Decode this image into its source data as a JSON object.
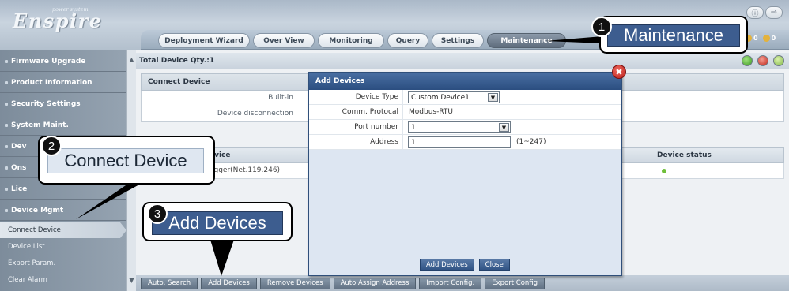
{
  "app": {
    "logo_sub": "power system",
    "logo_main": "Enspire"
  },
  "header": {
    "tabs": [
      {
        "label": "Deployment Wizard"
      },
      {
        "label": "Over View"
      },
      {
        "label": "Monitoring"
      },
      {
        "label": "Query"
      },
      {
        "label": "Settings"
      },
      {
        "label": "Maintenance"
      }
    ],
    "controls": [
      "help-icon",
      "logout-icon"
    ],
    "alarm_counts": [
      "0",
      "0"
    ]
  },
  "sidebar": {
    "items": [
      {
        "label": "Firmware Upgrade"
      },
      {
        "label": "Product Information"
      },
      {
        "label": "Security Settings"
      },
      {
        "label": "System Maint."
      },
      {
        "label": "Dev"
      },
      {
        "label": "Ons"
      },
      {
        "label": "Lice"
      },
      {
        "label": "Device Mgmt"
      }
    ],
    "sub_items": [
      {
        "label": "Connect Device"
      },
      {
        "label": "Device List"
      },
      {
        "label": "Export Param."
      },
      {
        "label": "Clear Alarm"
      }
    ]
  },
  "main": {
    "total_qty": "Total Device Qty.:1",
    "section_title": "Connect Device",
    "row1_label": "Built-in",
    "row2_label": "Device disconnection",
    "grid_col_device": "evice",
    "grid_col_status": "Device status",
    "grid_row_device": "ogger(Net.119.246)",
    "status_colors": [
      "#5cbf3d",
      "#d93a2b",
      "#9acd5e"
    ]
  },
  "bottom_buttons": [
    {
      "label": "Auto. Search"
    },
    {
      "label": "Add Devices"
    },
    {
      "label": "Remove Devices"
    },
    {
      "label": "Auto Assign Address"
    },
    {
      "label": "Import Config."
    },
    {
      "label": "Export Config"
    }
  ],
  "dialog": {
    "title": "Add Devices",
    "device_type_label": "Device Type",
    "device_type_value": "Custom Device1",
    "protocol_label": "Comm. Protocal",
    "protocol_value": "Modbus-RTU",
    "port_label": "Port number",
    "port_value": "1",
    "address_label": "Address",
    "address_value": "1",
    "address_range": "(1~247)",
    "add_button": "Add Devices",
    "close_button": "Close"
  },
  "callouts": [
    {
      "number": "1",
      "text": "Maintenance"
    },
    {
      "number": "2",
      "text": "Connect Device"
    },
    {
      "number": "3",
      "text": "Add Devices"
    }
  ]
}
